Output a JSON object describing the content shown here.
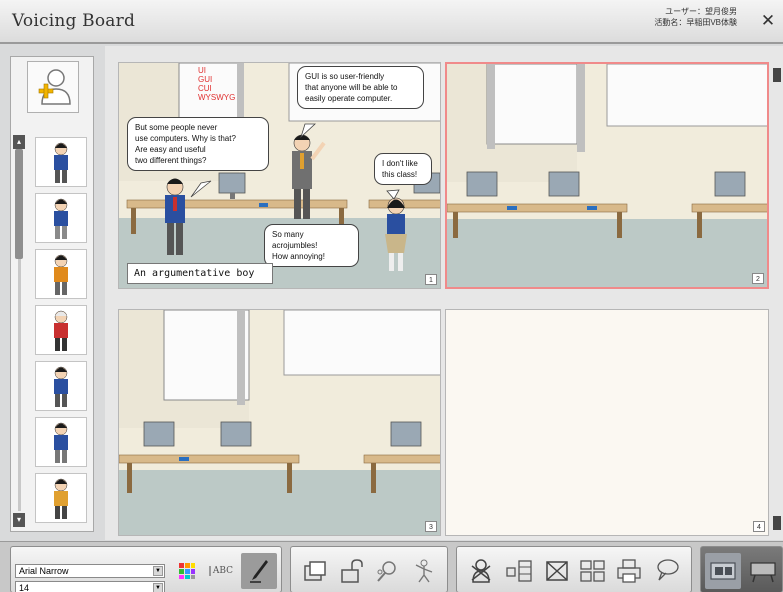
{
  "app": {
    "title": "Voicing Board",
    "user_line": "ユーザー：望月俊男",
    "activity_line": "活動名：早稲田VB体験",
    "close_glyph": "✕"
  },
  "sidebar": {
    "add_button": "add-character-icon",
    "characters": [
      {
        "hair": "#1a1a1a",
        "shirt": "#2a4fa0",
        "pants": "#555"
      },
      {
        "hair": "#1a1a1a",
        "shirt": "#2a4fa0",
        "pants": "#8a8a8a"
      },
      {
        "hair": "#1a1a1a",
        "shirt": "#e08a1c",
        "pants": "#666"
      },
      {
        "hair": "#e8e8e8",
        "shirt": "#c83030",
        "pants": "#333"
      },
      {
        "hair": "#1a1a1a",
        "shirt": "#2a4fa0",
        "pants": "#555"
      },
      {
        "hair": "#1a1a1a",
        "shirt": "#2a4fa0",
        "pants": "#777"
      },
      {
        "hair": "#1a1a1a",
        "shirt": "#e0a030",
        "pants": "#444"
      }
    ]
  },
  "panels": [
    {
      "number": "1",
      "selected": false,
      "red_words": "UI\nGUI\nCUI\nWYSWYG",
      "bubbles": {
        "boy": "But some people never\nuse computers. Why is that?\nAre easy and useful\ntwo different things?",
        "teacher": "GUI is so user-friendly\nthat anyone will be able to\neasily operate computer.",
        "girl": "I don't like\nthis class!",
        "annoyed": "So many acrojumbles!\nHow annoying!"
      },
      "caption": "An argumentative boy"
    },
    {
      "number": "2",
      "selected": true
    },
    {
      "number": "3",
      "selected": false
    },
    {
      "number": "4",
      "selected": false
    }
  ],
  "toolbar": {
    "font_name": "Arial Narrow",
    "font_size": "14",
    "abc_label": "ABC",
    "icons": [
      "color-palette-icon",
      "text-style-icon",
      "pen-icon",
      "bring-front-icon",
      "unlock-icon",
      "zoom-character-icon",
      "pose-icon",
      "add-character-icon",
      "panel-layout-icon",
      "delete-panel-icon",
      "arrange-panels-icon",
      "print-icon",
      "speech-icon",
      "filmstrip-view-icon",
      "board-view-icon"
    ]
  },
  "colors": {
    "wall": "#f1ecdc",
    "floor": "#bcc9c6",
    "desk_top": "#d8b98a",
    "desk_leg": "#8b6a40",
    "selected_border": "#f08a8a"
  }
}
